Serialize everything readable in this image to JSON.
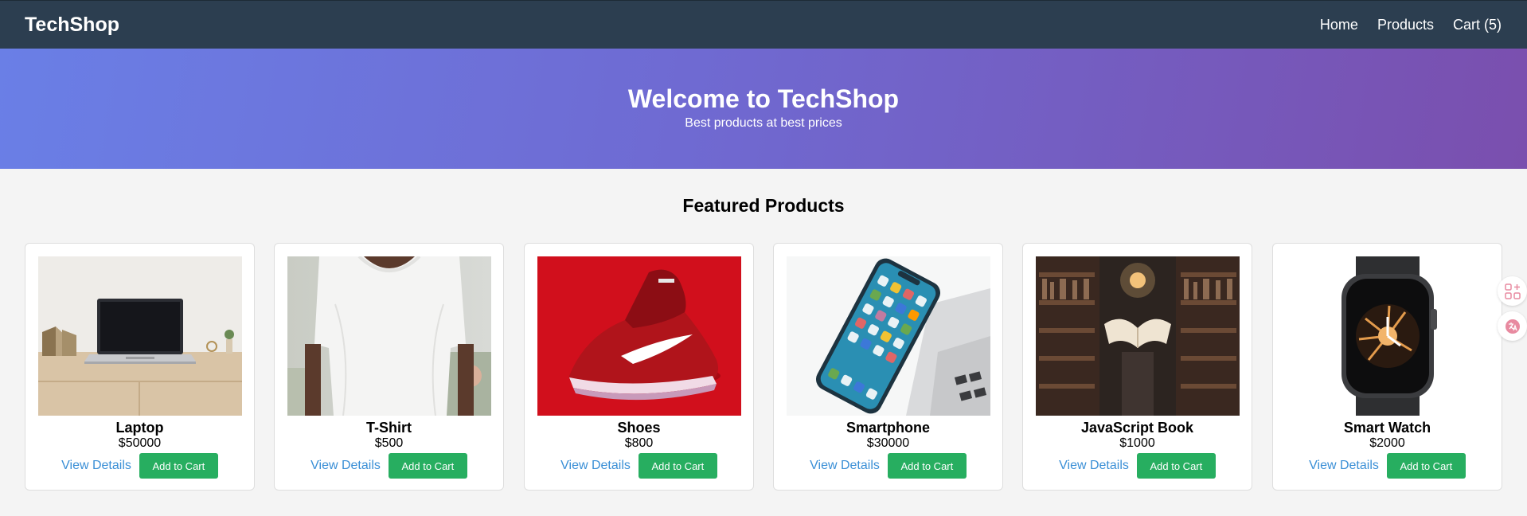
{
  "nav": {
    "brand": "TechShop",
    "links": [
      "Home",
      "Products",
      "Cart (5)"
    ]
  },
  "hero": {
    "title": "Welcome to TechShop",
    "subtitle": "Best products at best prices"
  },
  "featured": {
    "title": "Featured Products",
    "view_label": "View Details",
    "add_label": "Add to Cart",
    "products": [
      {
        "name": "Laptop",
        "price": "$50000",
        "image": "laptop-photo"
      },
      {
        "name": "T-Shirt",
        "price": "$500",
        "image": "tshirt-photo"
      },
      {
        "name": "Shoes",
        "price": "$800",
        "image": "shoes-photo"
      },
      {
        "name": "Smartphone",
        "price": "$30000",
        "image": "smartphone-photo"
      },
      {
        "name": "JavaScript Book",
        "price": "$1000",
        "image": "book-photo"
      },
      {
        "name": "Smart Watch",
        "price": "$2000",
        "image": "smartwatch-photo"
      }
    ]
  },
  "colors": {
    "navbar": "#2c3e50",
    "hero_start": "#6a7fe6",
    "hero_end": "#7a4fae",
    "add_button": "#27ae60",
    "link": "#3a8fd6"
  },
  "side_tools": [
    "apps-icon",
    "translate-icon"
  ]
}
